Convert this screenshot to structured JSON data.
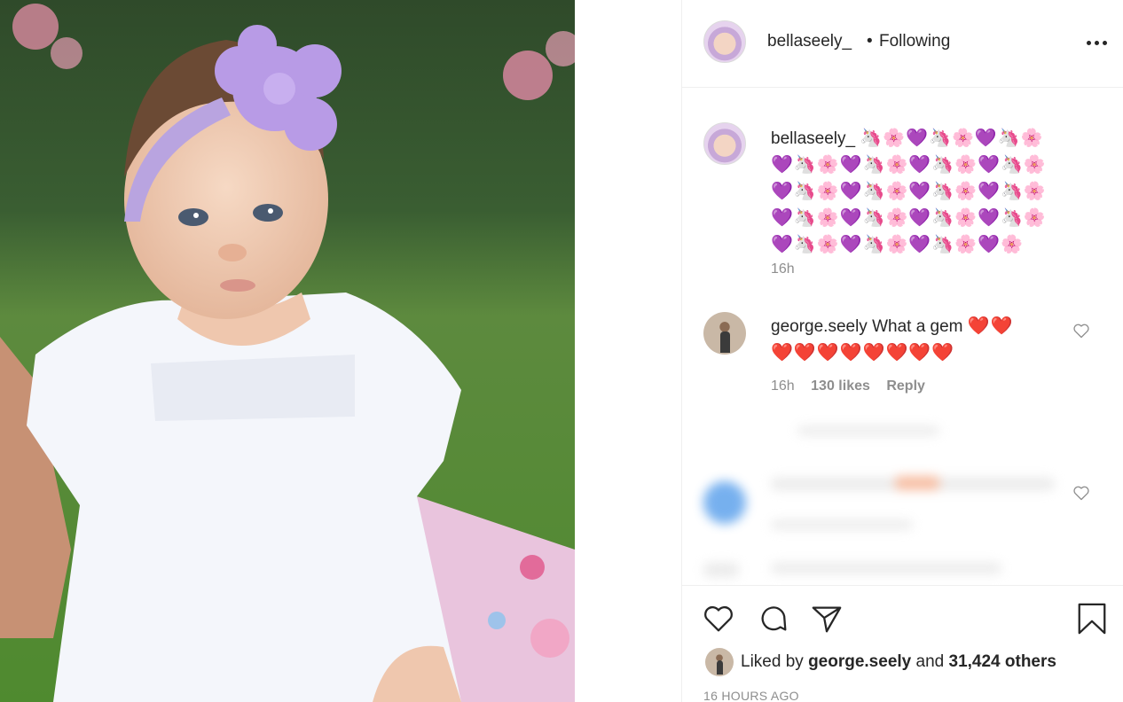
{
  "header": {
    "username": "bellaseely_",
    "separator": "•",
    "follow_status": "Following",
    "more_icon": "more-dots-icon"
  },
  "caption": {
    "username": "bellaseely_",
    "emoji_lines": [
      "🦄🌸💜🦄🌸💜🦄🌸",
      "💜🦄🌸💜🦄🌸💜🦄🌸💜🦄🌸",
      "💜🦄🌸💜🦄🌸💜🦄🌸💜🦄🌸",
      "💜🦄🌸💜🦄🌸💜🦄🌸💜🦄🌸",
      "💜🦄🌸💜🦄🌸💜🦄🌸💜🌸"
    ],
    "time": "16h"
  },
  "comment": {
    "username": "george.seely",
    "text": "What a gem",
    "emoji_inline": "❤️❤️",
    "emoji_line2": "❤️❤️❤️❤️❤️❤️❤️❤️",
    "time": "16h",
    "likes": "130 likes",
    "reply": "Reply"
  },
  "actions": {
    "like_icon": "heart-icon",
    "comment_icon": "comment-bubble-icon",
    "share_icon": "paper-plane-icon",
    "save_icon": "bookmark-icon"
  },
  "likes_summary": {
    "prefix": "Liked by",
    "liker": "george.seely",
    "joiner": "and",
    "others": "31,424 others"
  },
  "posted_ago": "16 HOURS AGO",
  "colors": {
    "text": "#262626",
    "muted": "#8e8e8e",
    "border": "#efefef",
    "accent_purple": "#b89be6"
  }
}
